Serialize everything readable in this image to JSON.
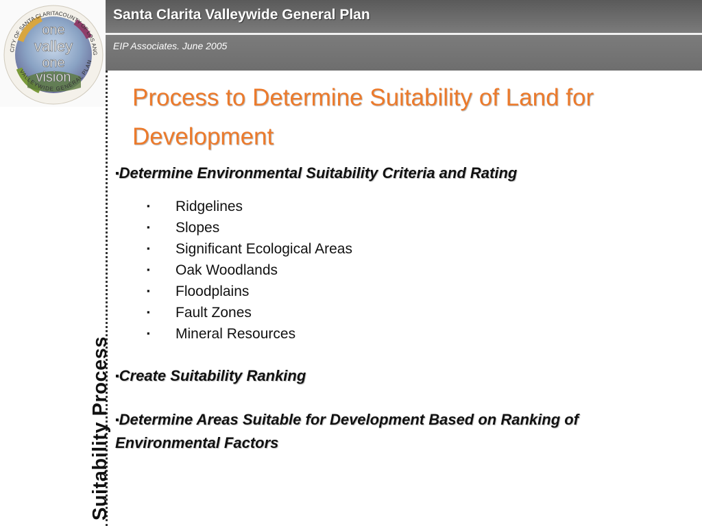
{
  "header": {
    "title": "Santa Clarita Valleywide General Plan",
    "subtitle": "EIP Associates.  June 2005"
  },
  "logo": {
    "ring_top_left": "CITY OF SANTA CLARITA",
    "ring_top_right": "COUNTY OF LOS ANGELES",
    "ring_bottom": "VALLEYWIDE GENERAL PLAN",
    "lines": [
      "one",
      "valley",
      "one",
      "vision"
    ]
  },
  "side_label": "Suitability Process",
  "slide": {
    "title": "Process to Determine Suitability of Land for Development",
    "bullet_marker": "▪",
    "bullets": [
      "Determine Environmental Suitability Criteria and Rating",
      "Create Suitability Ranking",
      "Determine Areas Suitable for Development Based on Ranking of Environmental Factors"
    ],
    "criteria": [
      "Ridgelines",
      "Slopes",
      "Significant Ecological Areas",
      "Oak Woodlands",
      "Floodplains",
      "Fault Zones",
      "Mineral Resources"
    ]
  },
  "colors": {
    "title_orange": "#ec7a2b",
    "header_gray": "#6e6e6e"
  }
}
